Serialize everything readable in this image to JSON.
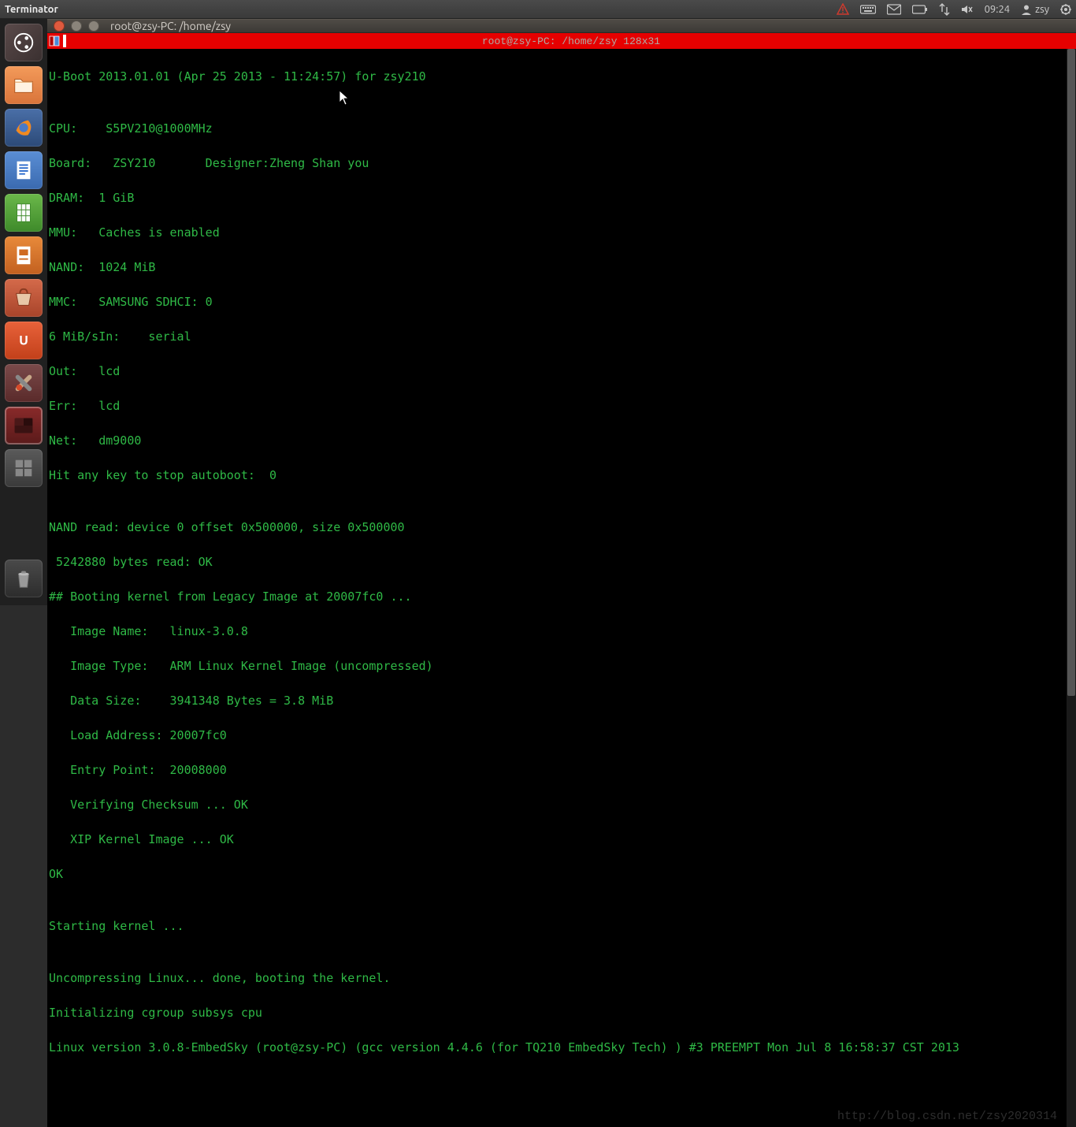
{
  "panel": {
    "app_name": "Terminator",
    "time": "09:24",
    "user": "zsy"
  },
  "window": {
    "title": "root@zsy-PC: /home/zsy"
  },
  "tab": {
    "title": "root@zsy-PC: /home/zsy 128x31"
  },
  "lines": {
    "l0": "U-Boot 2013.01.01 (Apr 25 2013 - 11:24:57) for zsy210",
    "l1": "",
    "l2": "CPU:    S5PV210@1000MHz",
    "l3": "Board:   ZSY210       Designer:Zheng Shan you",
    "l4": "DRAM:  1 GiB",
    "l5": "MMU:   Caches is enabled",
    "l6": "NAND:  1024 MiB",
    "l7": "MMC:   SAMSUNG SDHCI: 0",
    "l8": "6 MiB/sIn:    serial",
    "l9": "Out:   lcd",
    "l10": "Err:   lcd",
    "l11": "Net:   dm9000",
    "l12": "Hit any key to stop autoboot:  0",
    "l13": "",
    "l14": "NAND read: device 0 offset 0x500000, size 0x500000",
    "l15": " 5242880 bytes read: OK",
    "l16": "## Booting kernel from Legacy Image at 20007fc0 ...",
    "l17": "   Image Name:   linux-3.0.8",
    "l18": "   Image Type:   ARM Linux Kernel Image (uncompressed)",
    "l19": "   Data Size:    3941348 Bytes = 3.8 MiB",
    "l20": "   Load Address: 20007fc0",
    "l21": "   Entry Point:  20008000",
    "l22": "   Verifying Checksum ... OK",
    "l23": "   XIP Kernel Image ... OK",
    "l24": "OK",
    "l25": "",
    "l26": "Starting kernel ...",
    "l27": "",
    "l28": "Uncompressing Linux... done, booting the kernel.",
    "l29": "Initializing cgroup subsys cpu",
    "l30": "Linux version 3.0.8-EmbedSky (root@zsy-PC) (gcc version 4.4.6 (for TQ210 EmbedSky Tech) ) #3 PREEMPT Mon Jul 8 16:58:37 CST 2013"
  },
  "watermark": "http://blog.csdn.net/zsy2020314",
  "launcher": {
    "items": [
      {
        "name": "dash"
      },
      {
        "name": "files"
      },
      {
        "name": "firefox"
      },
      {
        "name": "writer"
      },
      {
        "name": "calc"
      },
      {
        "name": "impress"
      },
      {
        "name": "software-center"
      },
      {
        "name": "ubuntu-one"
      },
      {
        "name": "settings"
      },
      {
        "name": "terminal"
      },
      {
        "name": "workspace"
      }
    ]
  }
}
